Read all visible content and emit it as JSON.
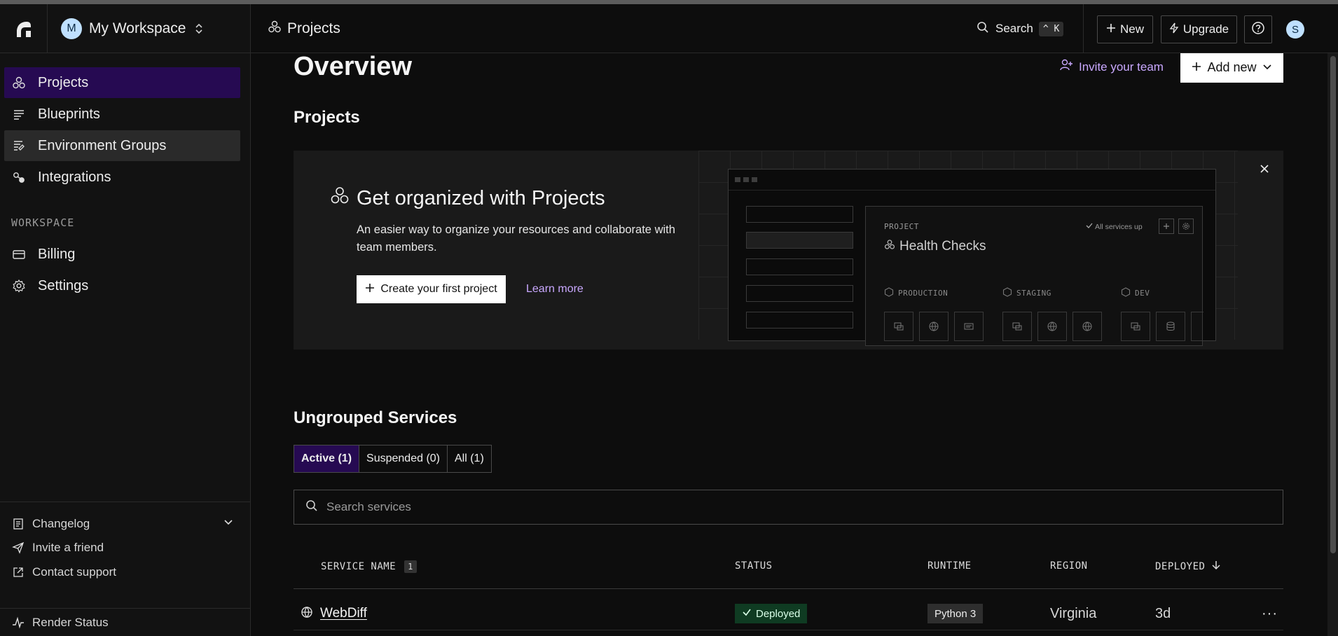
{
  "workspace": {
    "avatar_letter": "M",
    "name": "My Workspace"
  },
  "sidebar": {
    "items": [
      {
        "label": "Projects",
        "icon": "projects-icon"
      },
      {
        "label": "Blueprints",
        "icon": "blueprints-icon"
      },
      {
        "label": "Environment Groups",
        "icon": "env-groups-icon"
      },
      {
        "label": "Integrations",
        "icon": "integrations-icon"
      }
    ],
    "workspace_heading": "WORKSPACE",
    "workspace_items": [
      {
        "label": "Billing",
        "icon": "billing-icon"
      },
      {
        "label": "Settings",
        "icon": "gear-icon"
      }
    ],
    "footer": {
      "changelog": "Changelog",
      "invite": "Invite a friend",
      "support": "Contact support",
      "status": "Render Status"
    }
  },
  "topbar": {
    "breadcrumb": "Projects",
    "search_label": "Search",
    "search_shortcut": "^ K",
    "new_label": "New",
    "upgrade_label": "Upgrade",
    "user_avatar": "S"
  },
  "main": {
    "title": "Overview",
    "invite_label": "Invite your team",
    "add_new_label": "Add new",
    "projects_heading": "Projects",
    "banner": {
      "title": "Get organized with Projects",
      "description": "An easier way to organize your resources and collaborate with team members.",
      "create_label": "Create your first project",
      "learn_more": "Learn more",
      "illustration": {
        "project_label": "PROJECT",
        "project_name": "Health Checks",
        "services_up": "All services up",
        "environments": [
          "PRODUCTION",
          "STAGING",
          "DEV"
        ]
      }
    },
    "ungrouped_heading": "Ungrouped Services",
    "tabs": [
      {
        "label": "Active (1)",
        "active": true
      },
      {
        "label": "Suspended (0)",
        "active": false
      },
      {
        "label": "All (1)",
        "active": false
      }
    ],
    "search_placeholder": "Search services",
    "table": {
      "headers": {
        "name": "SERVICE NAME",
        "name_count": "1",
        "status": "STATUS",
        "runtime": "RUNTIME",
        "region": "REGION",
        "deployed": "DEPLOYED"
      },
      "rows": [
        {
          "name": "WebDiff",
          "status": "Deployed",
          "runtime": "Python 3",
          "region": "Virginia",
          "deployed": "3d",
          "more": "···"
        }
      ]
    }
  },
  "colors": {
    "accent_purple": "#260a52",
    "link_purple": "#c9a8ff",
    "deployed_green": "#0f3b22",
    "background": "#0d0d0d"
  }
}
